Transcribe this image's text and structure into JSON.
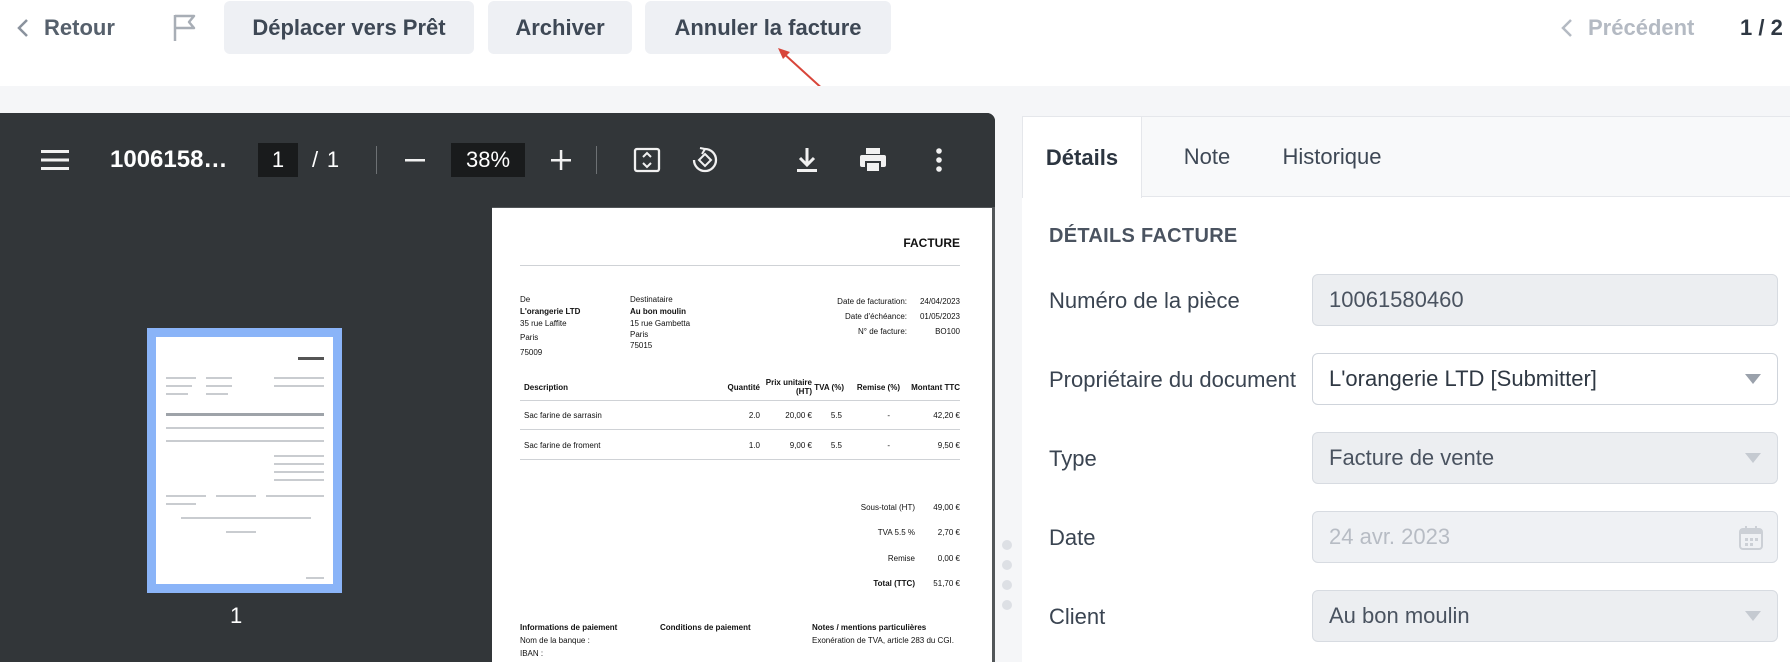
{
  "toolbar": {
    "back_label": "Retour",
    "move_label": "Déplacer vers Prêt",
    "archive_label": "Archiver",
    "cancel_label": "Annuler la facture",
    "prev_label": "Précédent",
    "page_count": "1 / 2",
    "annotation_color": "#d8453a"
  },
  "viewer": {
    "doc_title": "1006158…",
    "current_page": "1",
    "page_separator": "/",
    "total_pages": "1",
    "zoom": "38%",
    "thumb_label": "1",
    "icons": [
      "menu-icon",
      "zoom-out-icon",
      "zoom-in-icon",
      "fit-page-icon",
      "rotate-icon",
      "download-icon",
      "print-icon",
      "more-icon"
    ]
  },
  "invoice": {
    "title": "FACTURE",
    "from_label": "De",
    "from_name": "L'orangerie LTD",
    "from_street": "35 rue Laffite",
    "from_city": "Paris",
    "from_zip": "75009",
    "to_label": "Destinataire",
    "to_name": "Au bon moulin",
    "to_street": "15 rue Gambetta",
    "to_city": "Paris",
    "to_zip": "75015",
    "meta": [
      {
        "label": "Date de facturation:",
        "value": "24/04/2023"
      },
      {
        "label": "Date d'échéance:",
        "value": "01/05/2023"
      },
      {
        "label": "N° de facture:",
        "value": "BO100"
      }
    ],
    "columns": [
      "Description",
      "Quantité",
      "Prix unitaire (HT)",
      "TVA (%)",
      "Remise (%)",
      "Montant TTC"
    ],
    "rows": [
      [
        "Sac farine de sarrasin",
        "2.0",
        "20,00 €",
        "5.5",
        "-",
        "42,20 €"
      ],
      [
        "Sac farine de froment",
        "1.0",
        "9,00 €",
        "5.5",
        "-",
        "9,50 €"
      ]
    ],
    "totals": [
      {
        "label": "Sous-total (HT)",
        "value": "49,00 €"
      },
      {
        "label": "TVA 5.5 %",
        "value": "2,70 €"
      },
      {
        "label": "Remise",
        "value": "0,00 €"
      },
      {
        "label": "Total (TTC)",
        "value": "51,70 €"
      }
    ],
    "payment_info_title": "Informations de paiement",
    "payment_conditions_title": "Conditions de paiement",
    "notes_title": "Notes / mentions particulières",
    "bank_label": "Nom de la banque :",
    "iban_label": "IBAN :",
    "notes_text": "Exonération de TVA, article 283 du CGI."
  },
  "panel": {
    "tabs": [
      "Détails",
      "Note",
      "Historique"
    ],
    "section_title": "DÉTAILS FACTURE",
    "fields": [
      {
        "label": "Numéro de la pièce",
        "value": "10061580460"
      },
      {
        "label": "Propriétaire du document",
        "value": "L'orangerie LTD [Submitter]"
      },
      {
        "label": "Type",
        "value": "Facture de vente"
      },
      {
        "label": "Date",
        "value": "24 avr. 2023"
      },
      {
        "label": "Client",
        "value": "Au bon moulin"
      }
    ]
  }
}
